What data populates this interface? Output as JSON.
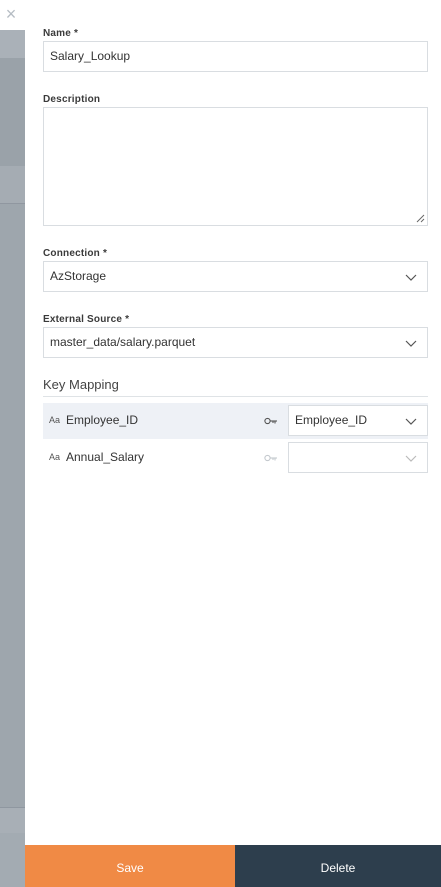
{
  "close": {
    "glyph": "×"
  },
  "form": {
    "name_label": "Name *",
    "name_value": "Salary_Lookup",
    "description_label": "Description",
    "description_value": "",
    "connection_label": "Connection *",
    "connection_value": "AzStorage",
    "external_source_label": "External Source *",
    "external_source_value": "master_data/salary.parquet"
  },
  "key_mapping": {
    "title": "Key Mapping",
    "rows": [
      {
        "type_icon": "Aa",
        "name": "Employee_ID",
        "key_icon": "key-icon",
        "selected": "Employee_ID"
      },
      {
        "type_icon": "Aa",
        "name": "Annual_Salary",
        "key_icon": "key-icon",
        "selected": ""
      }
    ]
  },
  "footer": {
    "save_label": "Save",
    "delete_label": "Delete"
  },
  "colors": {
    "save": "#f08a45",
    "delete": "#2d3e4d",
    "active_row": "#eef1f6"
  }
}
